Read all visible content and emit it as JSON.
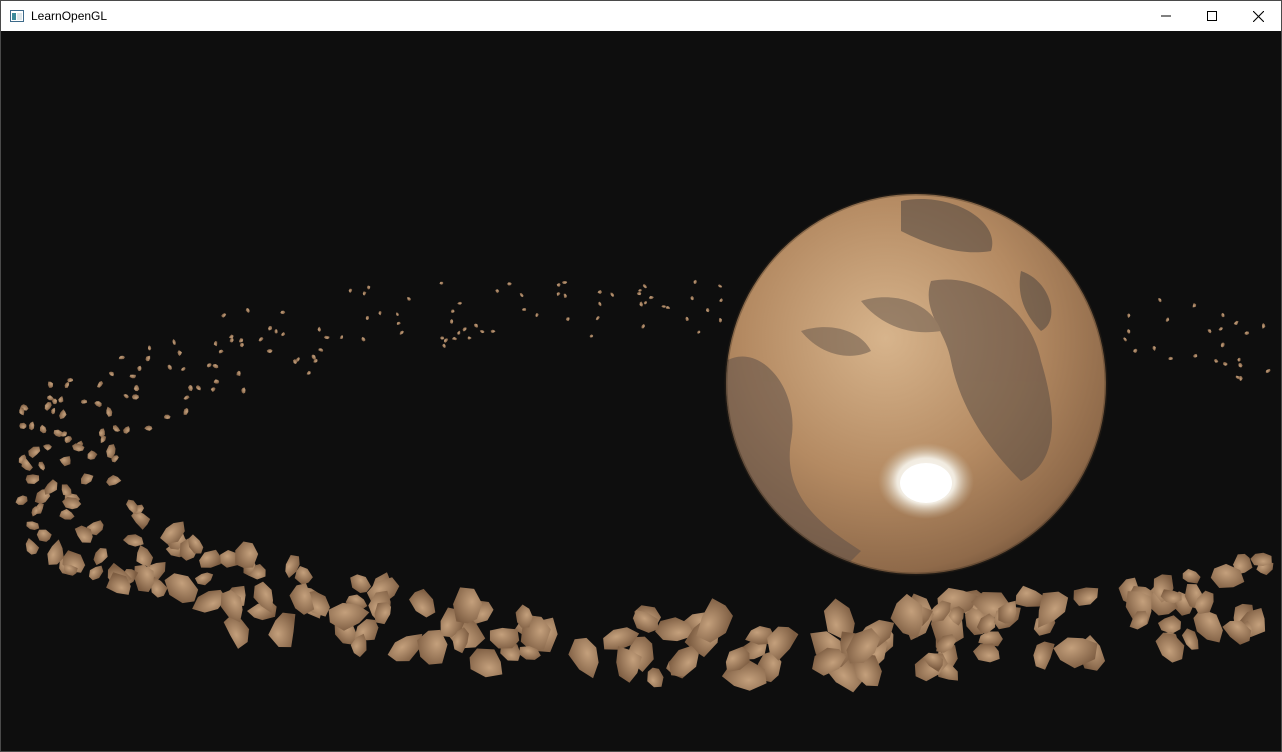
{
  "window": {
    "title": "LearnOpenGL",
    "icons": {
      "app": "window-app-icon",
      "minimize": "minimize-icon",
      "maximize": "maximize-icon",
      "close": "close-icon"
    }
  },
  "scene": {
    "description_colors": {
      "background": "#0e0e0e",
      "planet": "#c49a70",
      "rock": "#9b7656",
      "ice_cap": "#f4efe6"
    }
  }
}
